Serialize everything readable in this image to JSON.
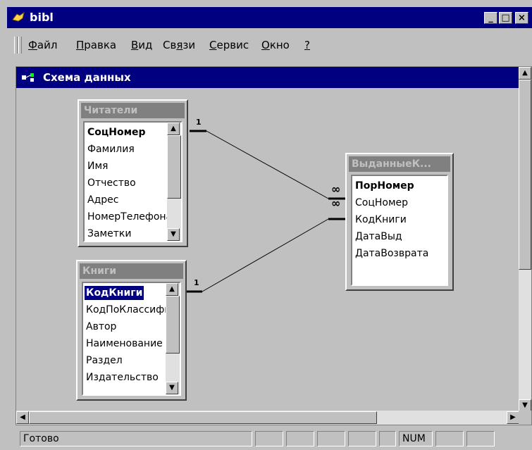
{
  "window": {
    "title": "bibl",
    "minimize": "_",
    "maximize": "□",
    "close": "×"
  },
  "menu": {
    "items": [
      {
        "u": "Ф",
        "rest": "айл"
      },
      {
        "u": "П",
        "rest": "равка"
      },
      {
        "u": "В",
        "rest": "ид"
      },
      {
        "pre": "Св",
        "u": "я",
        "rest": "зи"
      },
      {
        "u": "С",
        "rest": "ервис"
      },
      {
        "u": "О",
        "rest": "кно"
      },
      {
        "u": "?",
        "rest": ""
      }
    ]
  },
  "schema": {
    "title": "Схема данных"
  },
  "tables": {
    "readers": {
      "name": "Читатели",
      "fields": [
        "СоцНомер",
        "Фамилия",
        "Имя",
        "Отчество",
        "Адрес",
        "НомерТелефона",
        "Заметки"
      ]
    },
    "books": {
      "name": "Книги",
      "fields": [
        "КодКниги",
        "КодПоКлассификации",
        "Автор",
        "Наименование",
        "Раздел",
        "Издательство"
      ]
    },
    "issued": {
      "name": "ВыданныеК...",
      "fields": [
        "ПорНомер",
        "СоцНомер",
        "КодКниги",
        "ДатаВыд",
        "ДатаВозврата"
      ]
    }
  },
  "relations": {
    "one_label": "1",
    "many_label": "∞"
  },
  "status": {
    "text": "Готово",
    "num": "NUM"
  }
}
